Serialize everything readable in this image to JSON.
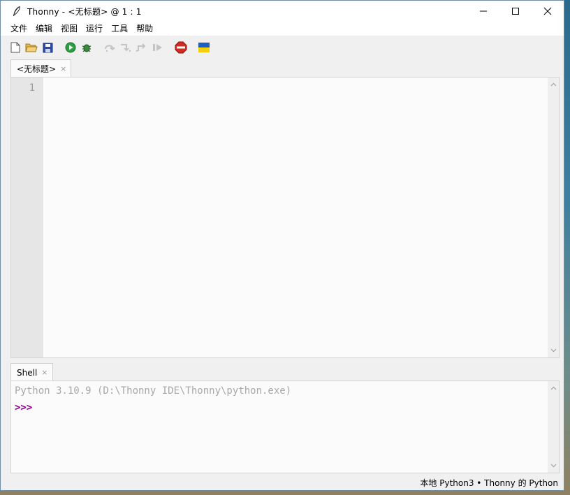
{
  "window": {
    "title": "Thonny  -  <无标题>  @  1 : 1"
  },
  "menu": {
    "items": [
      "文件",
      "编辑",
      "视图",
      "运行",
      "工具",
      "帮助"
    ]
  },
  "toolbar": {
    "buttons": [
      "new-file",
      "open-file",
      "save-file",
      "run",
      "debug",
      "step-over",
      "step-into",
      "step-out",
      "resume",
      "stop",
      "ukraine-flag"
    ]
  },
  "editor": {
    "tab_label": "<无标题>",
    "tab_close": "×",
    "line_numbers": [
      "1"
    ]
  },
  "shell": {
    "tab_label": "Shell",
    "tab_close": "×",
    "banner": "Python 3.10.9 (D:\\Thonny IDE\\Thonny\\python.exe)",
    "prompt": ">>>"
  },
  "status": {
    "interpreter": "本地 Python3  •  Thonny 的 Python"
  },
  "colors": {
    "prompt": "#8b008b",
    "banner": "#a8a8a8",
    "run_green": "#2ea043",
    "stop_red": "#d12a1f"
  }
}
